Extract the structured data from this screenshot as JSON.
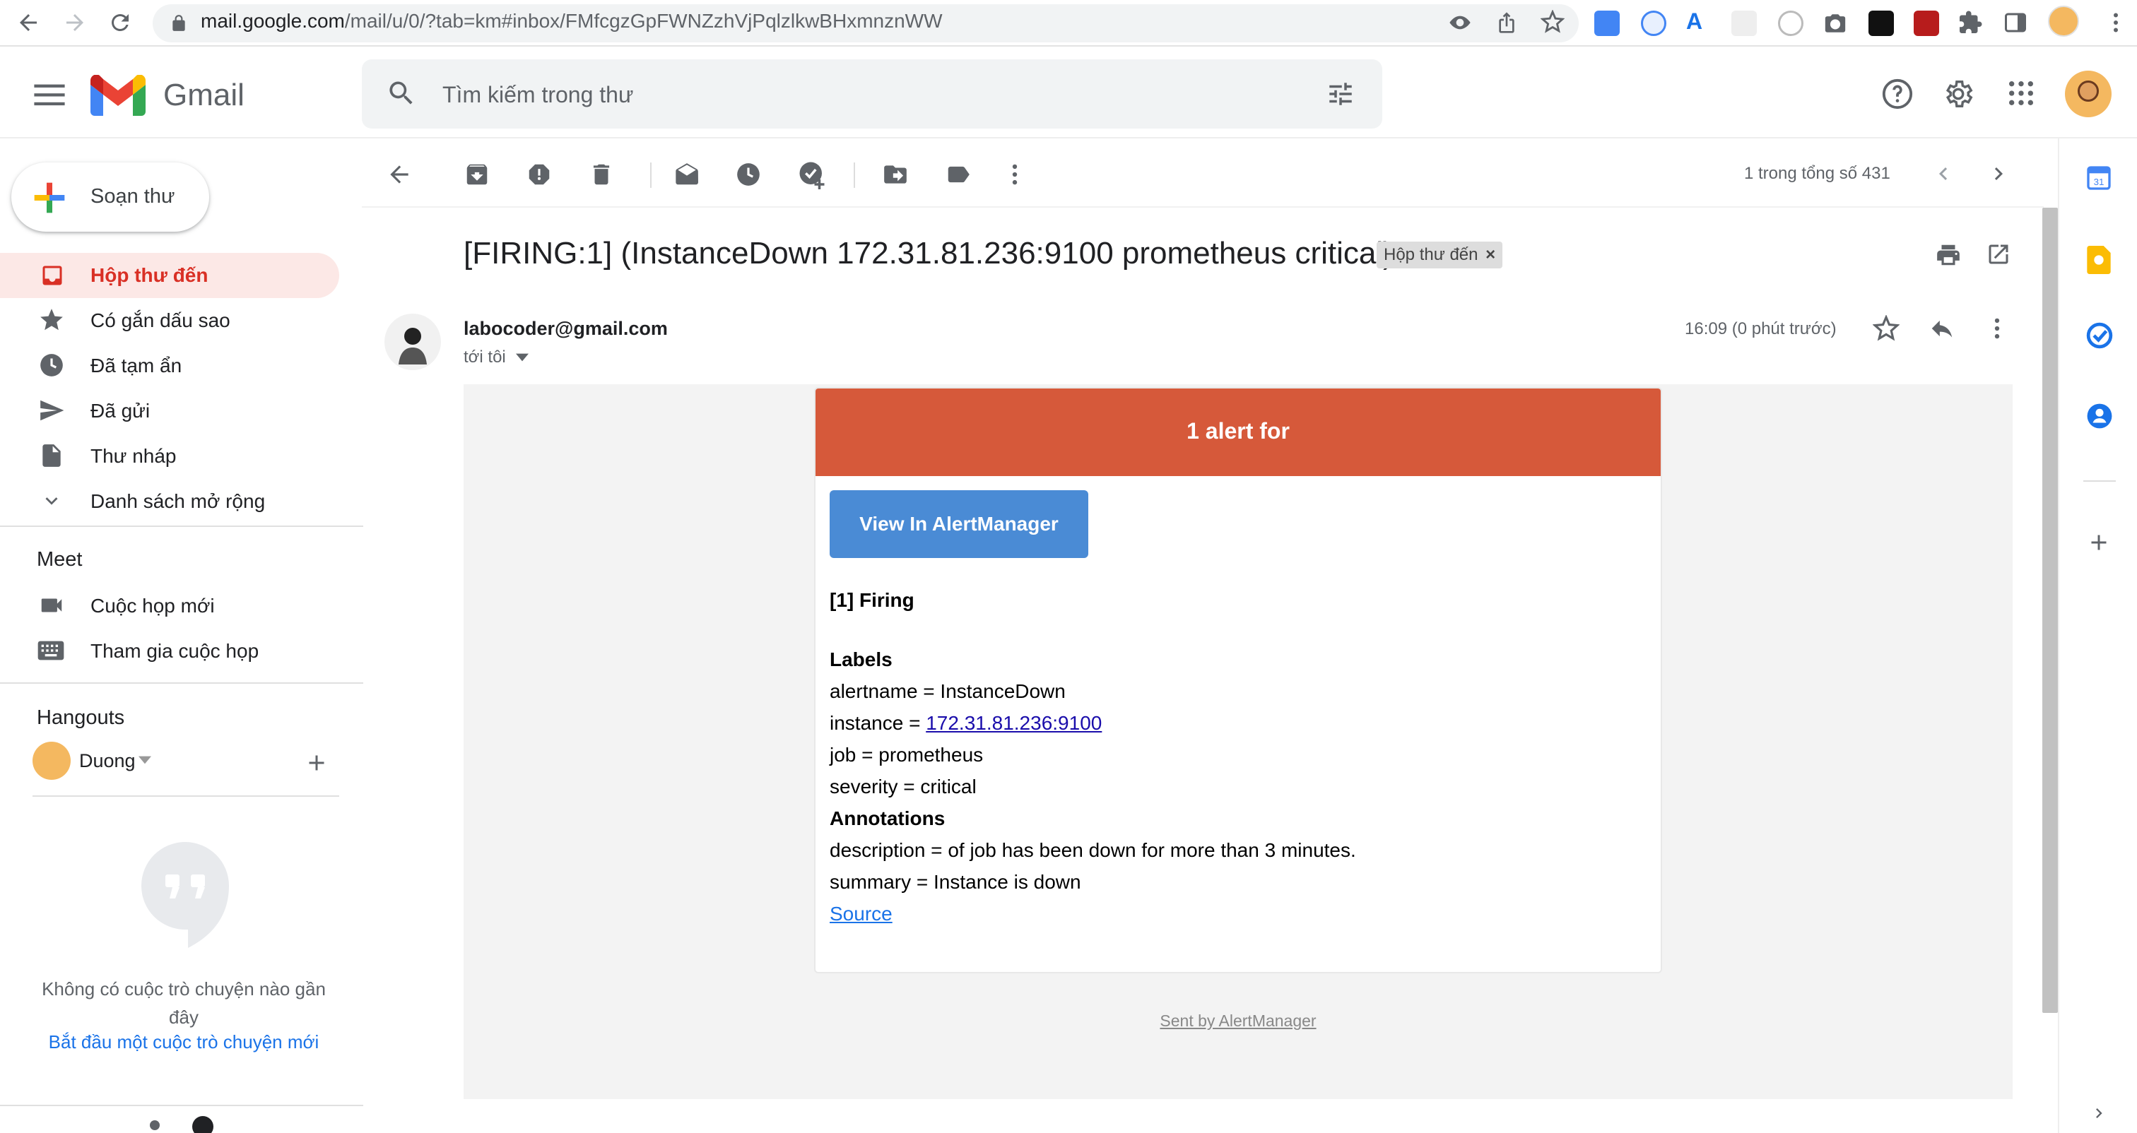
{
  "browser": {
    "url_host": "mail.google.com",
    "url_path": "/mail/u/0/?tab=km#inbox/FMfcgzGpFWNZzhVjPqlzlkwBHxmnznWW"
  },
  "header": {
    "app_name": "Gmail",
    "search_placeholder": "Tìm kiếm trong thư"
  },
  "sidebar": {
    "compose_label": "Soạn thư",
    "items": [
      {
        "label": "Hộp thư đến"
      },
      {
        "label": "Có gắn dấu sao"
      },
      {
        "label": "Đã tạm ẩn"
      },
      {
        "label": "Đã gửi"
      },
      {
        "label": "Thư nháp"
      },
      {
        "label": "Danh sách mở rộng"
      }
    ],
    "meet_title": "Meet",
    "meet_items": [
      {
        "label": "Cuộc họp mới"
      },
      {
        "label": "Tham gia cuộc họp"
      }
    ],
    "hangouts_title": "Hangouts",
    "hangouts_user": "Duong",
    "hangouts_empty": "Không có cuộc trò chuyện nào gần đây",
    "hangouts_start": "Bắt đầu một cuộc trò chuyện mới"
  },
  "toolbar": {
    "pager": "1 trong tổng số 431"
  },
  "message": {
    "subject": "[FIRING:1] (InstanceDown 172.31.81.236:9100 prometheus critical)",
    "tag": "Hộp thư đến",
    "sender": "labocoder@gmail.com",
    "to": "tới tôi",
    "time": "16:09 (0 phút trước)"
  },
  "email": {
    "alert_title": "1 alert for",
    "view_button": "View In AlertManager",
    "firing": "[1] Firing",
    "labels_title": "Labels",
    "alertname": "alertname = InstanceDown",
    "instance_prefix": "instance = ",
    "instance_link": "172.31.81.236:9100",
    "job": "job = prometheus",
    "severity": "severity = critical",
    "annotations_title": "Annotations",
    "description": "description = of job has been down for more than 3 minutes.",
    "summary": "summary = Instance is down",
    "source_link": "Source",
    "sent_by": "Sent by AlertManager"
  },
  "colors": {
    "alert_banner": "#d6593a",
    "view_button": "#4a8bd5",
    "active_nav": "#fce8e6",
    "active_text": "#d93025"
  }
}
